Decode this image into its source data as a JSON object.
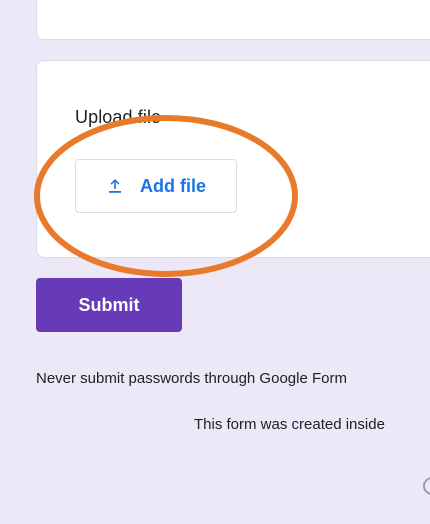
{
  "question": {
    "title": "Upload file"
  },
  "upload_button": {
    "label": "Add file",
    "icon": "upload-icon"
  },
  "submit_button": {
    "label": "Submit"
  },
  "footer": {
    "password_notice": "Never submit passwords through Google Form",
    "created_notice": "This form was created inside"
  },
  "colors": {
    "page_background": "#ede8f7",
    "accent": "#673ab7",
    "link": "#1a73e8",
    "annotation": "#e97a2b"
  }
}
